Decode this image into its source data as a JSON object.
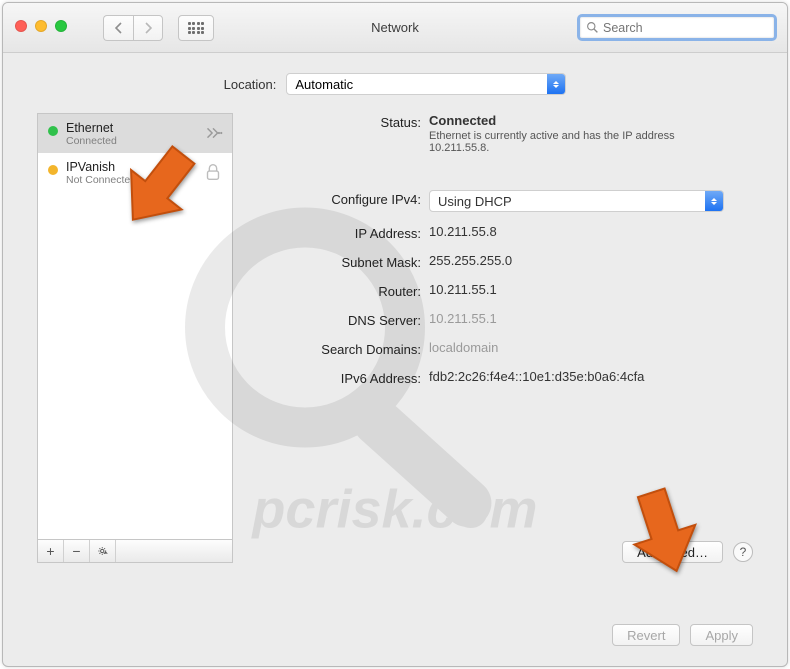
{
  "window": {
    "title": "Network"
  },
  "search": {
    "placeholder": "Search"
  },
  "location": {
    "label": "Location:",
    "value": "Automatic"
  },
  "sidebar": {
    "items": [
      {
        "name": "Ethernet",
        "status": "Connected",
        "color": "#30c14b"
      },
      {
        "name": "IPVanish",
        "status": "Not Connected",
        "color": "#f3b52c"
      }
    ]
  },
  "detail": {
    "status_label": "Status:",
    "status_value": "Connected",
    "status_sub": "Ethernet is currently active and has the IP address 10.211.55.8.",
    "configure_label": "Configure IPv4:",
    "configure_value": "Using DHCP",
    "ip_label": "IP Address:",
    "ip_value": "10.211.55.8",
    "subnet_label": "Subnet Mask:",
    "subnet_value": "255.255.255.0",
    "router_label": "Router:",
    "router_value": "10.211.55.1",
    "dns_label": "DNS Server:",
    "dns_value": "10.211.55.1",
    "search_domains_label": "Search Domains:",
    "search_domains_value": "localdomain",
    "ipv6_label": "IPv6 Address:",
    "ipv6_value": "fdb2:2c26:f4e4::10e1:d35e:b0a6:4cfa",
    "advanced_button": "Advanced…"
  },
  "footer": {
    "revert": "Revert",
    "apply": "Apply"
  },
  "watermark_text": "pcrisk.com"
}
